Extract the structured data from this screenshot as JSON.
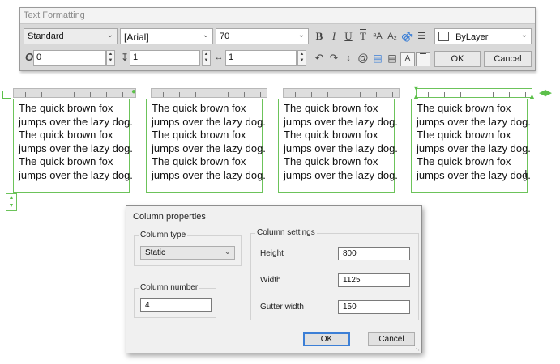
{
  "toolbar": {
    "title": "Text Formatting",
    "style_value": "Standard",
    "font_value": "[Arial]",
    "height_value": "70",
    "color_value": "ByLayer",
    "oblique_value": "0",
    "tracking_value": "1",
    "width_factor_value": "1",
    "ok_label": "OK",
    "cancel_label": "Cancel",
    "icons": {
      "bold": "B",
      "italic": "I",
      "underline": "U",
      "overline": "T",
      "uppercase": "ᵃA",
      "stack": "A₂",
      "symbol": "@",
      "oblique": "O"
    }
  },
  "columns": [
    {
      "lines": [
        "The quick brown fox",
        "jumps over the lazy dog.",
        "The quick brown fox",
        "jumps over the lazy dog.",
        "The quick brown fox",
        "jumps over the lazy dog."
      ]
    },
    {
      "lines": [
        "The quick brown fox",
        "jumps over the lazy dog.",
        "The quick brown fox",
        "jumps over the lazy dog.",
        "The quick brown fox",
        "jumps over the lazy dog."
      ]
    },
    {
      "lines": [
        "The quick brown fox",
        "jumps over the lazy dog.",
        "The quick brown fox",
        "jumps over the lazy dog.",
        "The quick brown fox",
        "jumps over the lazy dog."
      ]
    },
    {
      "lines": [
        "The quick brown fox",
        "jumps over the lazy dog.",
        "The quick brown fox",
        "jumps over the lazy dog.",
        "The quick brown fox",
        "jumps over the lazy dog."
      ]
    }
  ],
  "dialog": {
    "title": "Column properties",
    "column_type_label": "Column type",
    "column_type_value": "Static",
    "column_number_label": "Column number",
    "column_number_value": "4",
    "column_settings_label": "Column settings",
    "height_label": "Height",
    "height_value": "800",
    "width_label": "Width",
    "width_value": "1125",
    "gutter_label": "Gutter width",
    "gutter_value": "150",
    "ok_label": "OK",
    "cancel_label": "Cancel"
  },
  "colors": {
    "accent_green": "#5cc04a",
    "ok_focus": "#3c7fd6"
  }
}
